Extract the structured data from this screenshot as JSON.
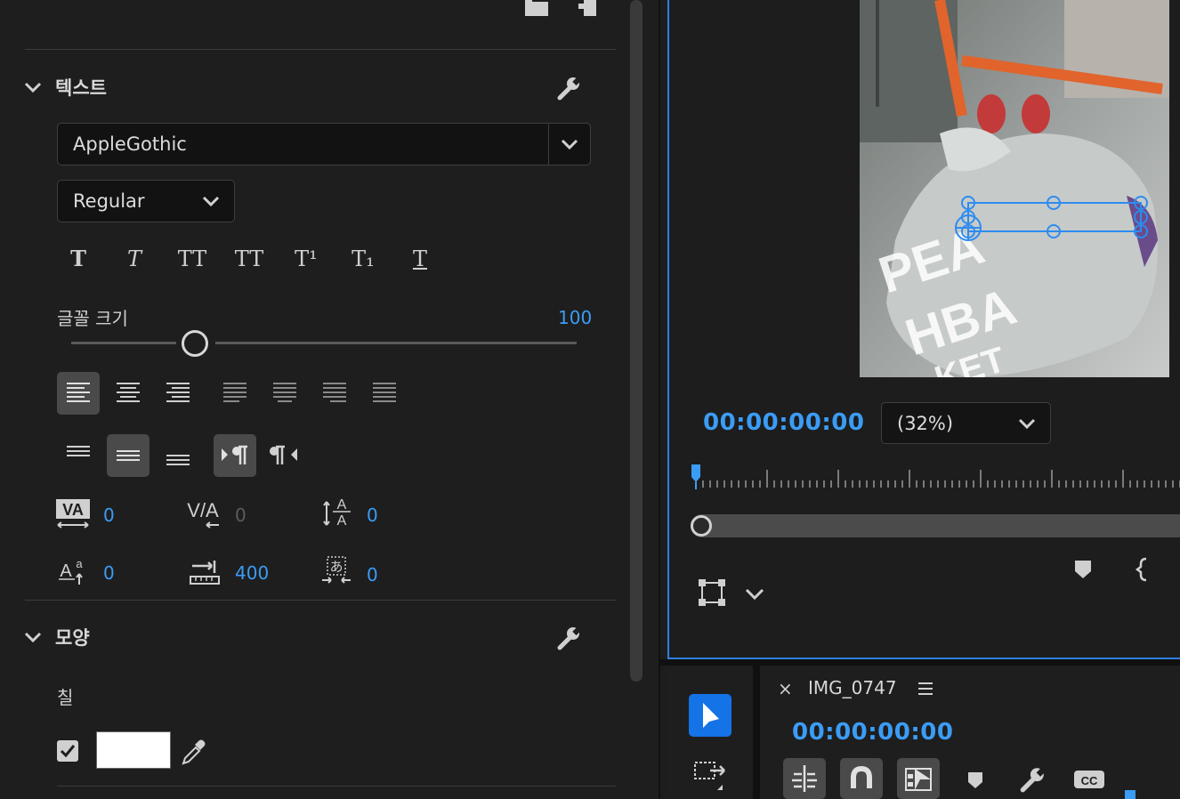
{
  "text_section": {
    "title": "텍스트",
    "font": "AppleGothic",
    "style": "Regular",
    "type_styles": [
      "T",
      "T",
      "TT",
      "TT",
      "T¹",
      "T₁",
      "T"
    ],
    "font_size_label": "글꼴 크기",
    "font_size_value": "100",
    "kerning": "0",
    "tracking": "0",
    "leading": "0",
    "baseline_shift": "0",
    "tab_width": "400",
    "tsume": "0"
  },
  "appearance_section": {
    "title": "모양",
    "fill_label": "칠",
    "fill_color": "#ffffff",
    "fill_enabled": true
  },
  "monitor": {
    "timecode": "00:00:00:00",
    "zoom": "(32%)"
  },
  "timeline": {
    "title": "IMG_0747",
    "close": "×",
    "timecode": "00:00:00:00"
  },
  "colors": {
    "accent": "#3b9cf5",
    "focus_border": "#2d7fe0",
    "tool_active": "#1473e6"
  }
}
